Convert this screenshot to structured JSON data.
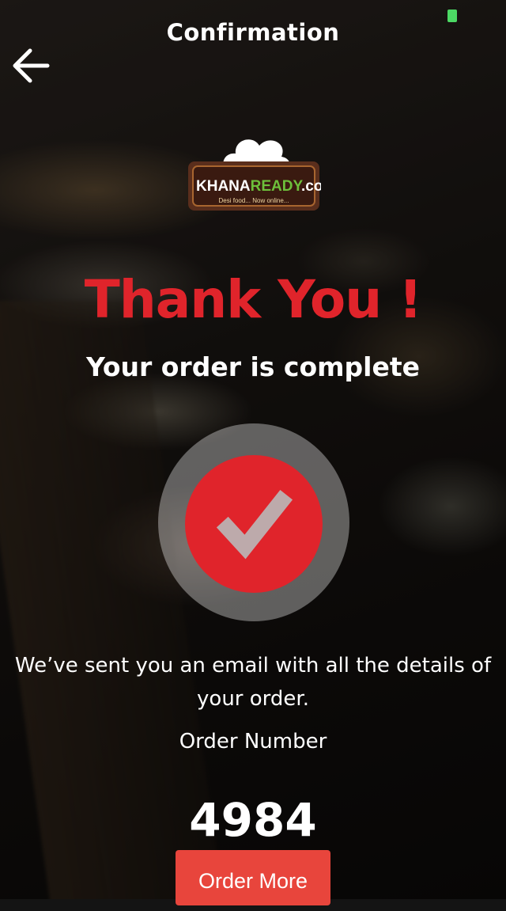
{
  "nav": {
    "title": "Confirmation",
    "back_icon": "arrow-left-icon"
  },
  "logo": {
    "text_khana": "KHANA",
    "text_ready": "READY",
    "text_com": ".com",
    "tagline": "Desi food... Now online..."
  },
  "confirmation": {
    "heading": "Thank You !",
    "subheading": "Your order is complete",
    "check_icon": "checkmark-icon",
    "message": "We’ve sent you an email with all the details of your order.",
    "order_label": "Order Number",
    "order_number": "4984"
  },
  "actions": {
    "order_more_label": "Order More"
  },
  "colors": {
    "accent_red": "#e0242b",
    "button_red": "#e8453c",
    "battery_green": "#4cd964"
  }
}
